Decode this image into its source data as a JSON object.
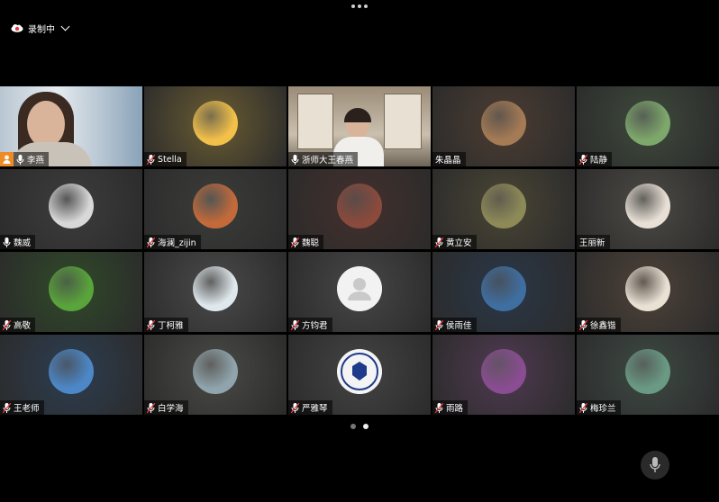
{
  "recording": {
    "label": "录制中"
  },
  "pagination": {
    "total": 2,
    "current": 2
  },
  "participants": [
    {
      "name": "李燕",
      "host": true,
      "active": false,
      "tile_color": "#5a7488",
      "avatar_color": "",
      "icon": "video-feed"
    },
    {
      "name": "Stella",
      "host": false,
      "active": false,
      "tile_color": "#6a5c32",
      "avatar_color": "#f3c04a",
      "icon": "silhouettes-avatar"
    },
    {
      "name": "浙师大王春燕",
      "host": false,
      "active": true,
      "tile_color": "#8a7e6c",
      "avatar_color": "",
      "icon": "video-feed"
    },
    {
      "name": "朱晶晶",
      "host": false,
      "active": false,
      "tile_color": "#4c3d32",
      "avatar_color": "#a57b55",
      "icon": "person-avatar",
      "muted_hidden": true
    },
    {
      "name": "陆静",
      "host": false,
      "active": false,
      "tile_color": "#3e4a3c",
      "avatar_color": "#7ea86b",
      "icon": "garden-avatar"
    },
    {
      "name": "魏威",
      "host": false,
      "active": false,
      "tile_color": "#3d3d3d",
      "avatar_color": "#d8d8d8",
      "icon": "person-avatar"
    },
    {
      "name": "海澜_zijin",
      "host": false,
      "active": false,
      "tile_color": "#3b3d3a",
      "avatar_color": "#c46a3a",
      "icon": "floral-avatar"
    },
    {
      "name": "魏聪",
      "host": false,
      "active": false,
      "tile_color": "#43302c",
      "avatar_color": "#8a4a3c",
      "icon": "flower-avatar"
    },
    {
      "name": "黄立安",
      "host": false,
      "active": false,
      "tile_color": "#4a4534",
      "avatar_color": "#8d8a58",
      "icon": "cat-avatar"
    },
    {
      "name": "王丽新",
      "host": false,
      "active": false,
      "tile_color": "#4d4a44",
      "avatar_color": "#e8e0d6",
      "icon": "girl-avatar",
      "muted_hidden": true
    },
    {
      "name": "高敬",
      "host": false,
      "active": false,
      "tile_color": "#2f4a28",
      "avatar_color": "#5aa43c",
      "icon": "field-avatar"
    },
    {
      "name": "丁柯雅",
      "host": false,
      "active": false,
      "tile_color": "#4a4a4a",
      "avatar_color": "#dfe8ec",
      "icon": "cartoon-avatar"
    },
    {
      "name": "方钧君",
      "host": false,
      "active": false,
      "tile_color": "#474747",
      "avatar_color": "#f2f2f2",
      "icon": "default-person-avatar"
    },
    {
      "name": "侯雨佳",
      "host": false,
      "active": false,
      "tile_color": "#2a3748",
      "avatar_color": "#3f6fa2",
      "icon": "beach-avatar"
    },
    {
      "name": "徐鑫锴",
      "host": false,
      "active": false,
      "tile_color": "#4e4238",
      "avatar_color": "#e9e1d4",
      "icon": "mouse-cartoon-avatar"
    },
    {
      "name": "王老师",
      "host": false,
      "active": false,
      "tile_color": "#2d3e52",
      "avatar_color": "#4c88c8",
      "icon": "sky-avatar"
    },
    {
      "name": "白学海",
      "host": false,
      "active": false,
      "tile_color": "#4a4a46",
      "avatar_color": "#8fa4ac",
      "icon": "sea-avatar"
    },
    {
      "name": "严雅琴",
      "host": false,
      "active": false,
      "tile_color": "#444444",
      "avatar_color": "#f4f4f4",
      "icon": "school-logo-avatar"
    },
    {
      "name": "雨路",
      "host": false,
      "active": false,
      "tile_color": "#503a52",
      "avatar_color": "#8a4c92",
      "icon": "sunset-avatar"
    },
    {
      "name": "梅珍兰",
      "host": false,
      "active": false,
      "tile_color": "#3e4a44",
      "avatar_color": "#6a9a84",
      "icon": "lake-avatar"
    }
  ]
}
